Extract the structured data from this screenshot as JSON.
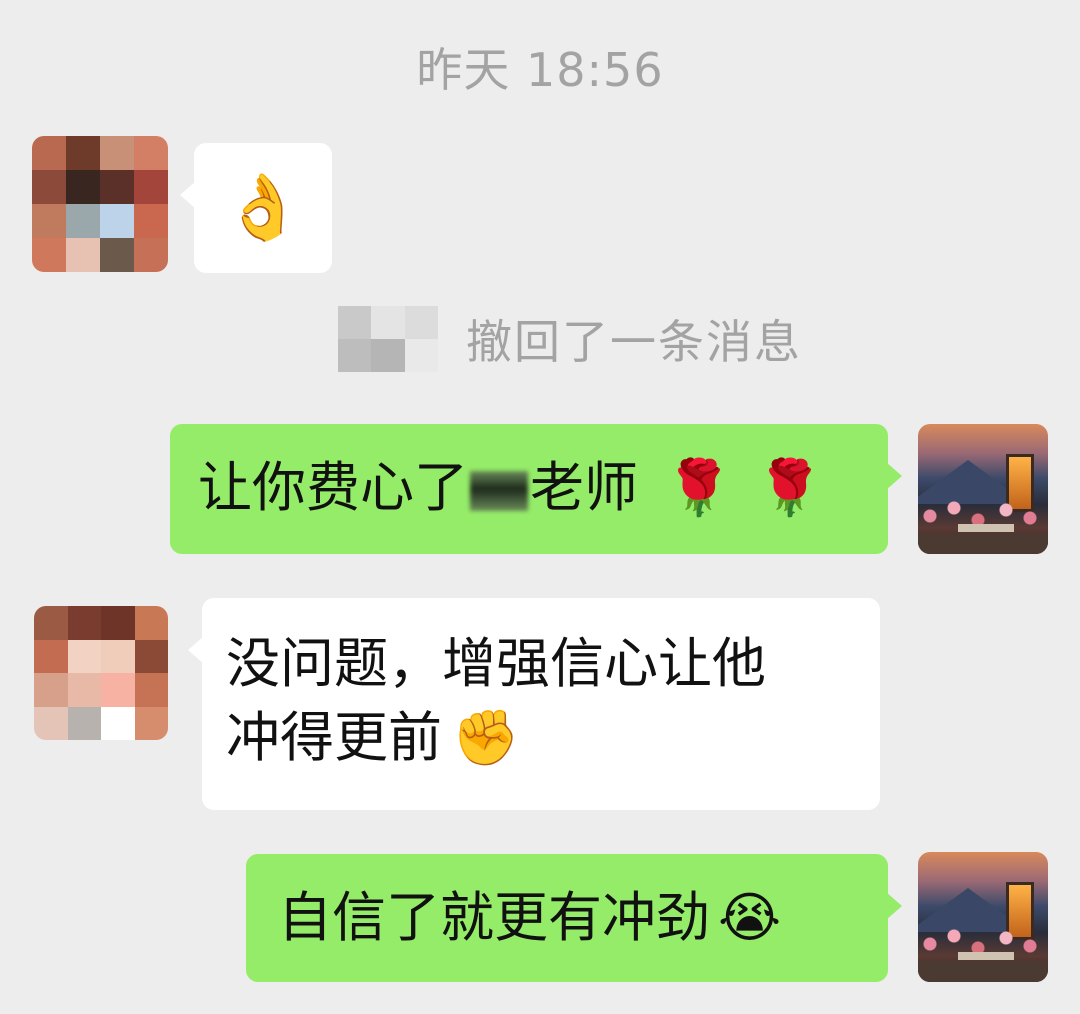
{
  "chat": {
    "timestamp": "昨天 18:56",
    "recall_notice": "撤回了一条消息",
    "messages": [
      {
        "side": "left",
        "text": "👌"
      },
      {
        "side": "right",
        "text_before": "让你费心了",
        "text_after": "老师",
        "emoji": "🌹🌹"
      },
      {
        "side": "left",
        "line1": "没问题，增强信心让他",
        "line2": "冲得更前",
        "emoji": "✊"
      },
      {
        "side": "right",
        "text": "自信了就更有冲劲",
        "emoji": "😭"
      }
    ]
  },
  "colors": {
    "background": "#ededed",
    "sent_bubble": "#95ec69",
    "received_bubble": "#ffffff",
    "system_text": "#a3a3a3"
  }
}
